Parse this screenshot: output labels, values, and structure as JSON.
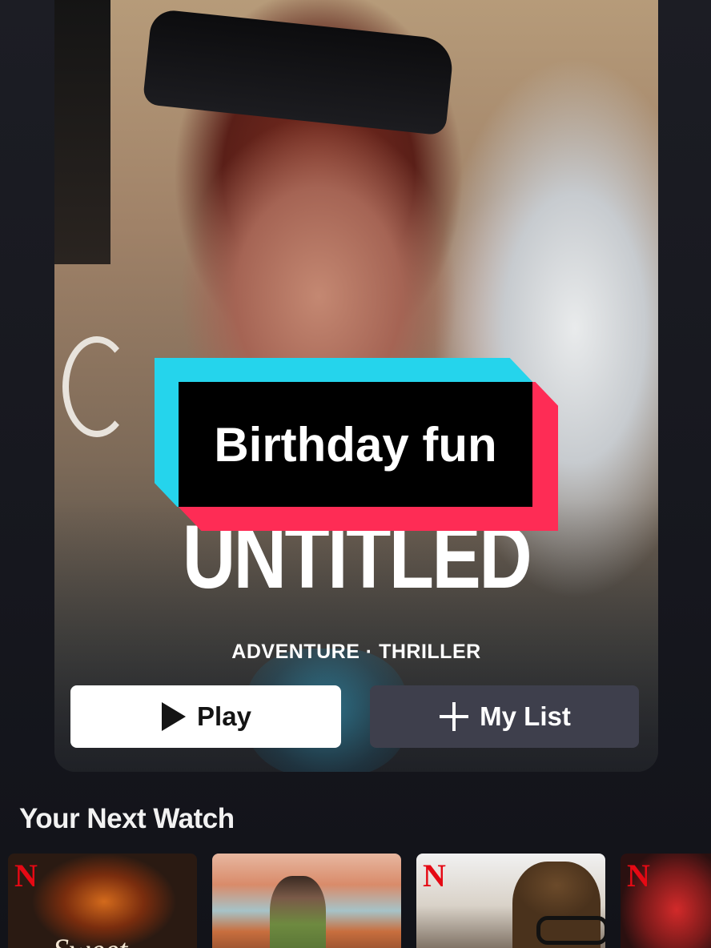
{
  "hero": {
    "title": "UNTITLED",
    "genres": "ADVENTURE · THRILLER",
    "play_label": "Play",
    "mylist_label": "My List"
  },
  "caption": {
    "text": "Birthday fun"
  },
  "section": {
    "title": "Your Next Watch",
    "items": [
      {
        "badge": "N",
        "title_text": "Sweet"
      },
      {
        "badge": ""
      },
      {
        "badge": "N"
      },
      {
        "badge": "N"
      }
    ]
  },
  "colors": {
    "caption_cyan": "#25d4ec",
    "caption_red": "#fe2c55",
    "netflix_red": "#e50914",
    "play_bg": "#ffffff",
    "mylist_bg": "#3e3f4c",
    "page_bg": "#16171e"
  },
  "icons": {
    "play": "play-icon",
    "add": "plus-icon",
    "badge": "netflix-n-icon"
  }
}
